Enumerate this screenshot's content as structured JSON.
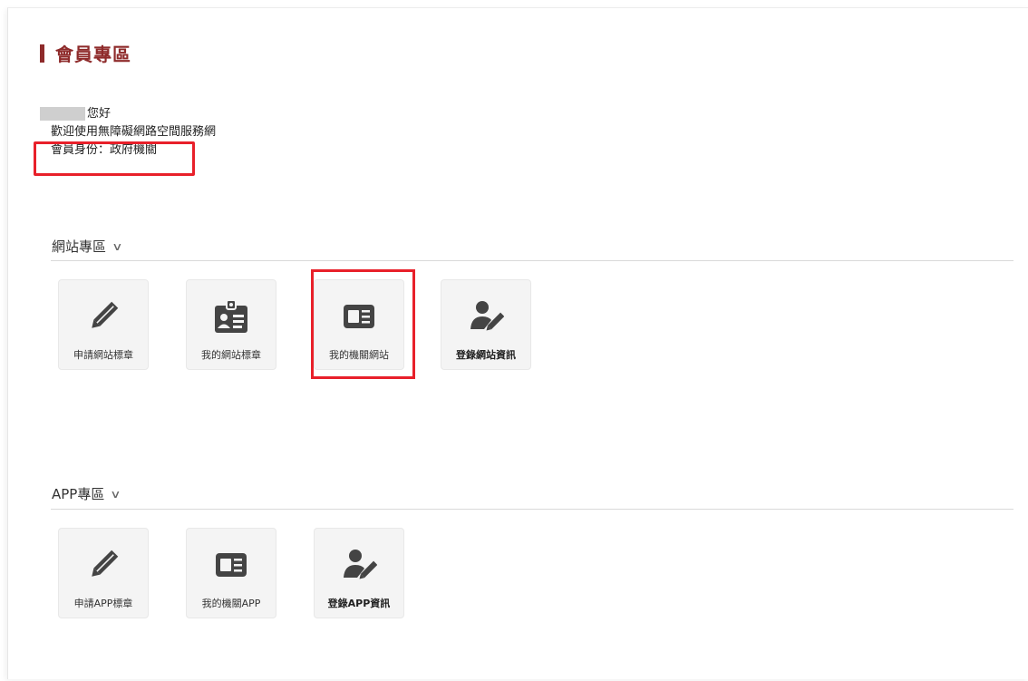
{
  "header": {
    "title": "會員專區"
  },
  "greeting": {
    "hello": "您好",
    "welcome": "歡迎使用無障礙網路空間服務網",
    "identity": "會員身份：政府機關"
  },
  "sections": [
    {
      "title": "網站專區",
      "tiles": [
        {
          "label": "申請網站標章",
          "icon": "pencil-icon"
        },
        {
          "label": "我的網站標章",
          "icon": "id-badge-icon"
        },
        {
          "label": "我的機關網站",
          "icon": "id-card-icon"
        },
        {
          "label": "登錄網站資訊",
          "icon": "user-edit-icon"
        }
      ]
    },
    {
      "title": "APP專區",
      "tiles": [
        {
          "label": "申請APP標章",
          "icon": "pencil-icon"
        },
        {
          "label": "我的機關APP",
          "icon": "id-card-icon"
        },
        {
          "label": "登錄APP資訊",
          "icon": "user-edit-icon"
        }
      ]
    }
  ],
  "colors": {
    "accent": "#8e2a2a",
    "highlight": "#e8202a",
    "tile_bg": "#f4f4f4",
    "icon": "#444444"
  }
}
